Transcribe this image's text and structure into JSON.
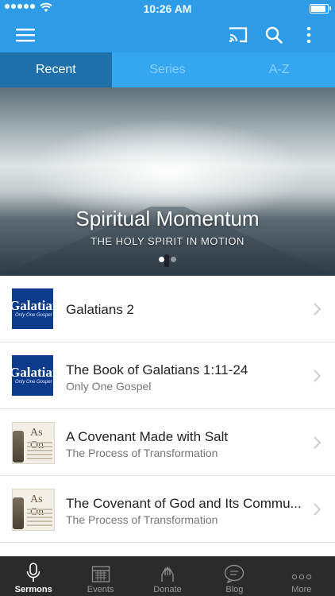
{
  "status_bar": {
    "time": "10:26 AM"
  },
  "tabs": [
    "Recent",
    "Series",
    "A-Z"
  ],
  "hero": {
    "title": "Spiritual Momentum",
    "subtitle": "THE HOLY SPIRIT IN MOTION",
    "page_count": 2,
    "current_page": 1
  },
  "sermons": [
    {
      "title": "Galatians 2",
      "subtitle": "",
      "thumb_text": "Galatians",
      "thumb_sub": "Only One Gospel"
    },
    {
      "title": "The Book of Galatians 1:11-24",
      "subtitle": "Only One Gospel",
      "thumb_text": "Galatians",
      "thumb_sub": "Only One Gospel"
    },
    {
      "title": "A Covenant Made with Salt",
      "subtitle": "The Process of Transformation",
      "thumb_text": "As On"
    },
    {
      "title": "The Covenant of God and Its Commu...",
      "subtitle": "The Process of Transformation",
      "thumb_text": "As On"
    }
  ],
  "tabbar": [
    "Sermons",
    "Events",
    "Donate",
    "Blog",
    "More"
  ],
  "colors": {
    "primary": "#2d9be5",
    "tab_active": "#1f70a8",
    "tabbar_bg": "#2b2b2b"
  }
}
